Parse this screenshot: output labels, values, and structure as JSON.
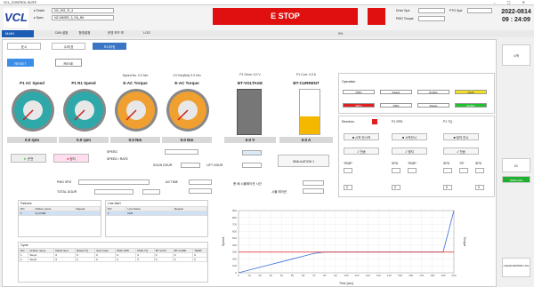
{
  "window": {
    "title": "VCL_CONTROL SUITE"
  },
  "header": {
    "field1_label": "♦ Tester",
    "field1_value": "NX_501_R_4",
    "field2_label": "♦ Spec",
    "field2_value": "NZ-MMSR_3_SA_B6",
    "estop_label": "E STOP",
    "status": [
      {
        "label": "Drive Spd",
        "value": ""
      },
      {
        "label": "PMG Torque",
        "value": ""
      }
    ],
    "status_right": {
      "label": "PTO Spd",
      "value": ""
    },
    "date": "2022-0814",
    "time": "09 : 24:09"
  },
  "nav": {
    "main_tab": "MAIN",
    "items": [
      "CAN 설정",
      "환경설정",
      "운영 모드 보",
      "LOG"
    ],
    "progress_label": "0%"
  },
  "subtabs": [
    "표시",
    "수치/표",
    "모니터링"
  ],
  "modes": [
    "RESET",
    "RESE"
  ],
  "gauges": [
    {
      "title": "P1 AC Speed",
      "value": "0.0 rpm",
      "color": "#2ea8a8"
    },
    {
      "title": "P1 R1 Speed",
      "value": "0.0 rpm",
      "color": "#2ea8a8"
    },
    {
      "title": "E-AC Torque",
      "value": "0.0 Nm",
      "color": "#f0a030",
      "head": "Speed No. 0.0 Nm"
    },
    {
      "title": "E-AC Torque",
      "value": "0.0 Nm",
      "color": "#f0a030",
      "head": "0.0 Nm(Set) 0.0 Nm"
    }
  ],
  "bars": [
    {
      "head": "P1 Drive: 0.0 V",
      "title": "BT-VOLTAGE",
      "value": "0.0 V",
      "level": 0
    },
    {
      "head": "P1 Curr: 0.0 A",
      "title": "BT-CURRENT",
      "value": "0.0 A",
      "level": 0.4
    }
  ],
  "controls": {
    "run_label": "운전",
    "stop_label": "정지",
    "set_label": "SET",
    "enter_label": "ENTER",
    "table_labels": [
      "SPEED",
      "SPEED / RATE",
      "SOUN DOUR",
      "LIFT DOUR"
    ],
    "start_button": "SIMULATION 1",
    "row2_labels": [
      "PMG SPD",
      "TOTAL DOUR",
      "AS TIME"
    ],
    "comp_label": "총 배 시뮬레이션 시간",
    "comp2_label": "시뮬 레이션"
  },
  "operation": {
    "title": "Operation",
    "row1": [
      "PMG",
      "Ready",
      "Enable",
      "Fault"
    ],
    "row2": [
      "MCU",
      "PMG",
      "Ready",
      "Enable"
    ],
    "direction_label": "Direction",
    "col_labels": [
      "P1 SPD",
      "P1 TQ"
    ],
    "buttons": [
      "■ 시작 전시작",
      "■ 시작전시",
      "■ 정지 전시",
      "■ 정지/전시"
    ],
    "check_labels": [
      "✓ 전송",
      "✓ 정지",
      "✓ 전송",
      "✓ 정지"
    ],
    "grid_labels": [
      "TEMP",
      "SPD",
      "TEMP",
      "SPD",
      "T/P",
      "SPD"
    ],
    "sub_values": [
      "0",
      "0",
      "0",
      "0"
    ]
  },
  "tables": {
    "left": {
      "title": "Failures",
      "headers": [
        "NO",
        "Failure name",
        "Repeat"
      ],
      "rows": [
        [
          "1",
          "E_FUSE",
          ""
        ]
      ]
    },
    "middle": {
      "title": "Line Alert",
      "headers": [
        "NO",
        "Line Name",
        "Repeat"
      ],
      "rows": [
        [
          "1",
          "FAN",
          ""
        ]
      ]
    },
    "bottom": {
      "title": "Cycle",
      "headers": [
        "NO",
        "Vehicle name",
        "Rated Spd",
        "Rated TQ",
        "Spd mode",
        "PMG SPD",
        "PMG TQ",
        "BT VOLT",
        "BT CURR",
        "TEMP"
      ],
      "rows": [
        [
          "1",
          "Step1",
          "0",
          "0",
          "0",
          "0",
          "0",
          "0",
          "0",
          "0"
        ],
        [
          "2",
          "Step2",
          "0",
          "0",
          "0",
          "0",
          "0",
          "0",
          "0",
          "0"
        ]
      ]
    }
  },
  "chart_data": {
    "type": "line",
    "title": "",
    "xlabel": "Time [sec]",
    "ylabel": "Speed",
    "ylabel2": "Torque",
    "x": [
      0,
      10,
      20,
      30,
      40,
      50,
      60,
      70,
      80,
      90,
      100,
      110,
      120,
      130,
      140,
      150,
      160,
      170,
      180,
      190,
      200
    ],
    "series": [
      {
        "name": "",
        "color": "#3a6fd8",
        "values": [
          0,
          40,
          80,
          120,
          160,
          200,
          240,
          280,
          300,
          300,
          300,
          300,
          300,
          300,
          300,
          300,
          300,
          300,
          300,
          300,
          900
        ]
      },
      {
        "name": "",
        "color": "#e04040",
        "values": [
          300,
          300,
          300,
          300,
          300,
          300,
          300,
          300,
          300,
          300,
          300,
          300,
          300,
          300,
          300,
          300,
          300,
          300,
          300,
          300,
          300
        ]
      }
    ],
    "ylim": [
      0,
      900
    ],
    "grid": true
  },
  "side": {
    "top_btn": "시작",
    "mid_btn": "ID",
    "green_btn": "SIMULATE",
    "bottom_btn": "CLEAR ERROR LOG"
  }
}
